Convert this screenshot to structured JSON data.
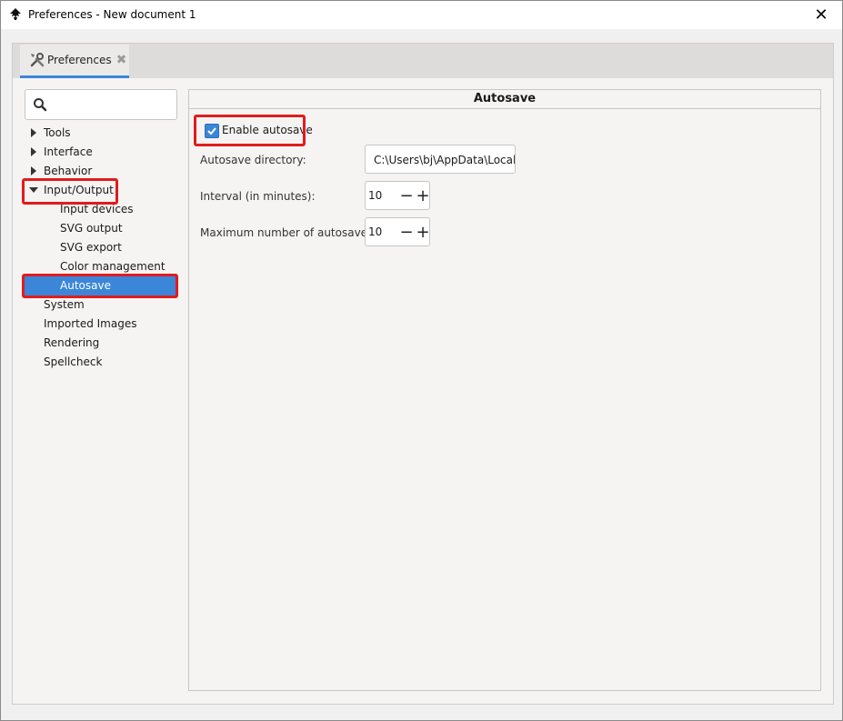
{
  "window": {
    "title": "Preferences - New document 1",
    "close_glyph": "✕"
  },
  "tabs": [
    {
      "label": "Preferences",
      "close_glyph": "✖"
    }
  ],
  "search": {
    "value": ""
  },
  "tree": {
    "tools": "Tools",
    "interface": "Interface",
    "behavior": "Behavior",
    "input_output": "Input/Output",
    "input_devices": "Input devices",
    "svg_output": "SVG output",
    "svg_export": "SVG export",
    "color_management": "Color management",
    "autosave": "Autosave",
    "system": "System",
    "imported_images": "Imported Images",
    "rendering": "Rendering",
    "spellcheck": "Spellcheck"
  },
  "page": {
    "title": "Autosave",
    "enable_autosave": {
      "label": "Enable autosave",
      "checked": true
    },
    "directory_label": "Autosave directory:",
    "directory_value": "C:\\Users\\bj\\AppData\\Local\\Inkscape",
    "interval_label": "Interval (in minutes):",
    "interval_value": "10",
    "max_label": "Maximum number of autosaves:",
    "max_value": "10",
    "minus_glyph": "−",
    "plus_glyph": "+"
  },
  "colors": {
    "accent": "#3b86d9",
    "highlight": "#e11c1c"
  }
}
